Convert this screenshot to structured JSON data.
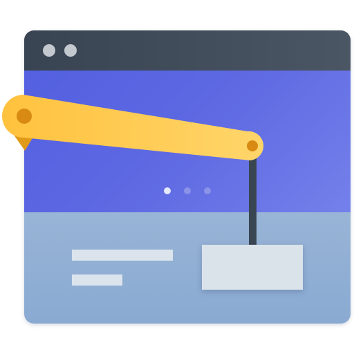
{
  "window": {
    "titlebar_color": "#394452",
    "control_dots": [
      "window-dot-1",
      "window-dot-2"
    ]
  },
  "hero": {
    "color": "#5d68e2",
    "carousel": {
      "count": 3,
      "active_index": 0,
      "active_color": "#e6e9fb",
      "inactive_color": "#8a93e8"
    }
  },
  "content": {
    "color": "#8aaad2",
    "placeholder_lines": 2
  },
  "crane": {
    "arm_color": "#ffc44a",
    "pivot_color": "#d88a12",
    "cable_color": "#3a4552"
  },
  "cargo": {
    "color": "#dbe3ea"
  }
}
